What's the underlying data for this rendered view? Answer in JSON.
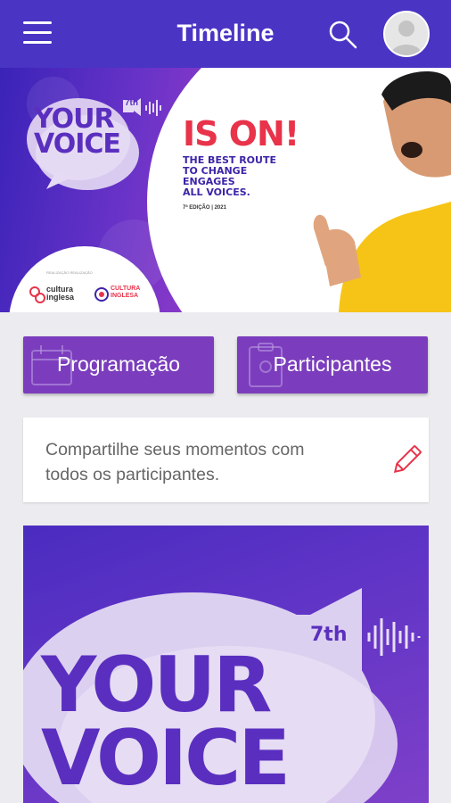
{
  "header": {
    "title": "Timeline",
    "menu_icon": "menu-icon",
    "search_icon": "search-icon",
    "avatar_icon": "avatar-icon"
  },
  "banner": {
    "logo_line1": "YOUR",
    "logo_line2": "VOICE",
    "edition_badge": "7th",
    "headline": "IS ON!",
    "tagline": [
      "THE BEST ROUTE",
      "TO CHANGE",
      "ENGAGES",
      "ALL VOICES."
    ],
    "edition_text": "7ª EDIÇÃO | 2021",
    "sponsor_caption": "REALIZAÇÃO REALIZAÇÃO",
    "sponsor1_line1": "cultura",
    "sponsor1_line2": "inglesa",
    "sponsor2_line1": "CULTURA",
    "sponsor2_line2": "INGLESA"
  },
  "nav": {
    "programacao": "Programação",
    "participantes": "Participantes"
  },
  "share": {
    "text": "Compartilhe seus momentos com todos os participantes.",
    "icon": "pencil-icon"
  },
  "post": {
    "logo_line1": "YOUR",
    "logo_line2": "VOICE",
    "edition_badge": "7th"
  },
  "colors": {
    "primary": "#4a34c4",
    "card_purple": "#7b3dbd",
    "accent_red": "#e8334a",
    "background": "#ececf0"
  }
}
